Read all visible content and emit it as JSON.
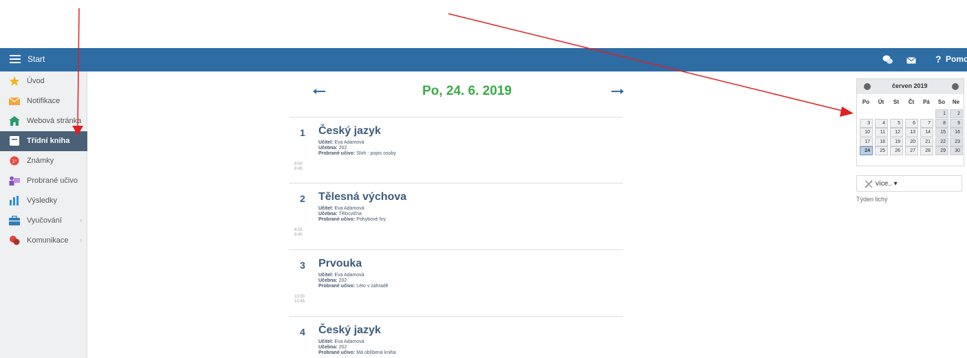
{
  "topbar": {
    "start_label": "Start",
    "help_label": "Pomoc",
    "help_symbol": "?"
  },
  "sidebar": {
    "items": [
      {
        "label": "Úvod",
        "icon": "star-icon"
      },
      {
        "label": "Notifikace",
        "icon": "envelope-icon"
      },
      {
        "label": "Webová stránka",
        "icon": "house-icon"
      },
      {
        "label": "Třídní kniha",
        "icon": "book-icon"
      },
      {
        "label": "Známky",
        "icon": "grade-icon"
      },
      {
        "label": "Probrané učivo",
        "icon": "teacher-icon"
      },
      {
        "label": "Výsledky",
        "icon": "bar-chart-icon"
      },
      {
        "label": "Vyučování",
        "icon": "briefcase-icon"
      },
      {
        "label": "Komunikace",
        "icon": "chat-icon"
      }
    ],
    "active_index": 3
  },
  "day": {
    "title": "Po, 24. 6. 2019"
  },
  "lessons": [
    {
      "number": "1",
      "subject": "Český jazyk",
      "teacher_label": "Učitel:",
      "teacher": "Eva Adamová",
      "room_label": "Učebna:",
      "room": "202",
      "topic_label": "Probrané učivo:",
      "topic": "Sloh - popis osoby",
      "time_start": "8:00",
      "time_end": "8:45"
    },
    {
      "number": "2",
      "subject": "Tělesná výchova",
      "teacher_label": "Učitel:",
      "teacher": "Eva Adamová",
      "room_label": "Učebna:",
      "room": "Tělocvična",
      "topic_label": "Probrané učivo:",
      "topic": "Pohybové hry",
      "time_start": "8:55",
      "time_end": "9:40"
    },
    {
      "number": "3",
      "subject": "Prvouka",
      "teacher_label": "Učitel:",
      "teacher": "Eva Adamová",
      "room_label": "Učebna:",
      "room": "202",
      "topic_label": "Probrané učivo:",
      "topic": "Léto v zahradě",
      "time_start": "10:00",
      "time_end": "10:45"
    },
    {
      "number": "4",
      "subject": "Český jazyk",
      "teacher_label": "Učitel:",
      "teacher": "Eva Adamová",
      "room_label": "Učebna:",
      "room": "202",
      "topic_label": "Probrané učivo:",
      "topic": "Má oblíbená kniha",
      "time_start": "",
      "time_end": ""
    }
  ],
  "calendar": {
    "month": "červen 2019",
    "weekdays": [
      "Po",
      "Út",
      "St",
      "Čt",
      "Pá",
      "So",
      "Ne"
    ],
    "weeks": [
      [
        "",
        "",
        "",
        "",
        "",
        "1",
        "2"
      ],
      [
        "3",
        "4",
        "5",
        "6",
        "7",
        "8",
        "9"
      ],
      [
        "10",
        "11",
        "12",
        "13",
        "14",
        "15",
        "16"
      ],
      [
        "17",
        "18",
        "19",
        "20",
        "21",
        "22",
        "23"
      ],
      [
        "24",
        "25",
        "26",
        "27",
        "28",
        "29",
        "30"
      ]
    ],
    "selected_day": "24"
  },
  "more_button": {
    "label": "více.. ▾"
  },
  "week_info": "Týden lichý",
  "colors": {
    "topbar": "#2e6ca4",
    "date_title": "#3aab46",
    "annotation_arrow": "#e02020"
  }
}
